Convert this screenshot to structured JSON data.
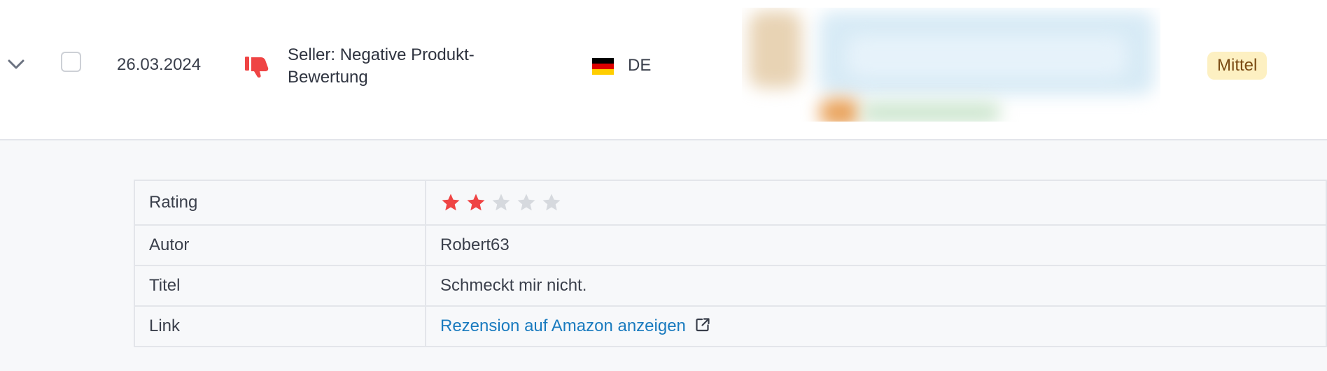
{
  "row": {
    "date": "26.03.2024",
    "type_label": "Seller: Negative Produkt-Bewertung",
    "country_code": "DE",
    "severity": "Mittel"
  },
  "details": {
    "rating_label": "Rating",
    "rating_value": 2,
    "rating_max": 5,
    "author_label": "Autor",
    "author_value": "Robert63",
    "title_label": "Titel",
    "title_value": "Schmeckt mir nicht.",
    "link_label": "Link",
    "link_text": "Rezension auf Amazon anzeigen"
  },
  "colors": {
    "star_filled": "#ef4444",
    "star_empty": "#d6d9de",
    "thumb_down": "#ef4444",
    "link": "#1a7bbf",
    "severity_bg": "#fdf0c2",
    "severity_text": "#7a4a12"
  },
  "icons": {
    "expand": "chevron-down-icon",
    "type": "thumbs-down-icon",
    "flag": "germany-flag-icon",
    "external": "external-link-icon"
  }
}
